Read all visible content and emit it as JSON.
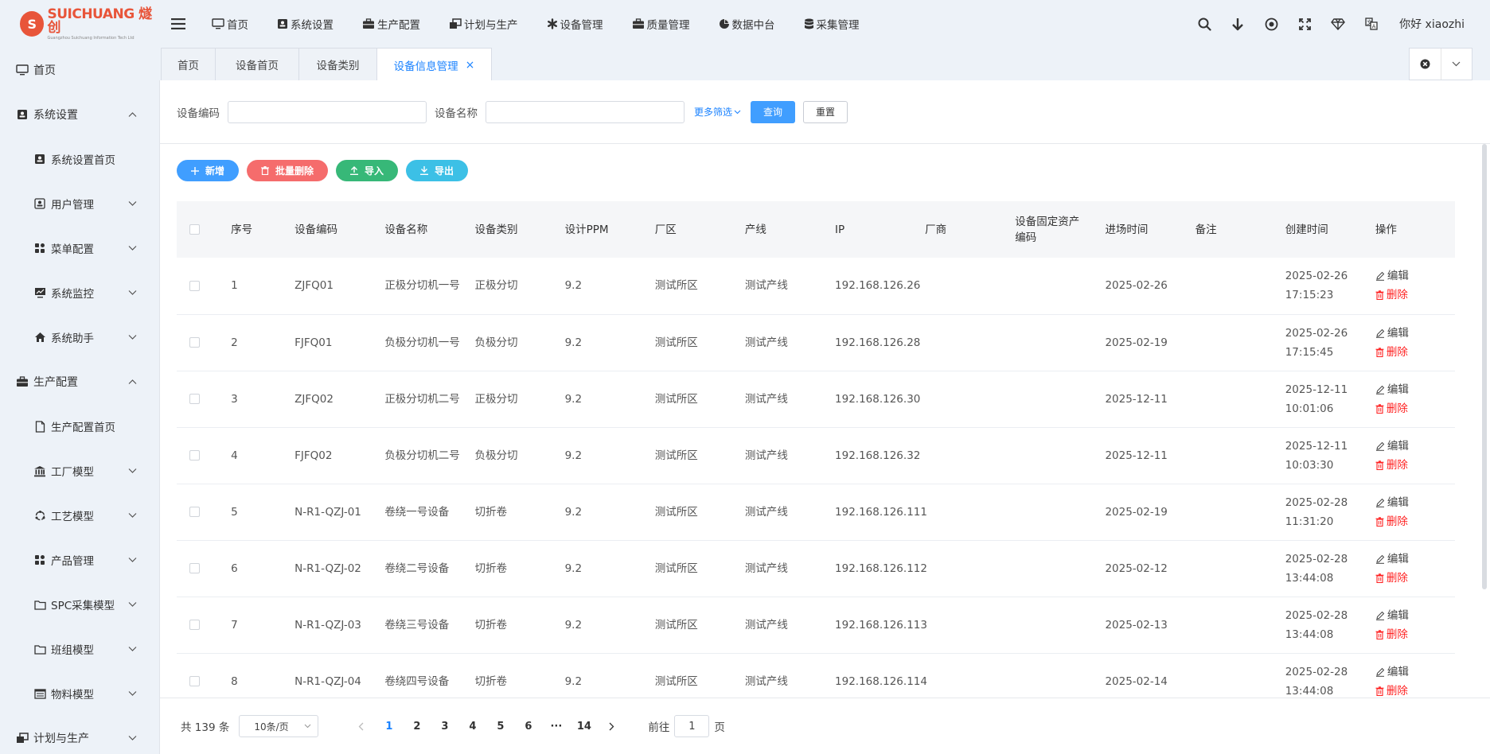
{
  "brand": {
    "logo_main": "SUICHUANG 燧创",
    "logo_sub": "Guangzhou Suichuang Information Tech Ltd",
    "logo_mark": "S"
  },
  "topnav": [
    {
      "label": "首页",
      "icon": "monitor-icon"
    },
    {
      "label": "系统设置",
      "icon": "user-card-icon"
    },
    {
      "label": "生产配置",
      "icon": "briefcase-icon"
    },
    {
      "label": "计划与生产",
      "icon": "windows-icon"
    },
    {
      "label": "设备管理",
      "icon": "gear-star-icon"
    },
    {
      "label": "质量管理",
      "icon": "briefcase-icon"
    },
    {
      "label": "数据中台",
      "icon": "pie-icon"
    },
    {
      "label": "采集管理",
      "icon": "database-icon"
    }
  ],
  "header": {
    "greeting": "你好 xiaozhi"
  },
  "sidebar": [
    {
      "label": "首页",
      "level": 0,
      "icon": "monitor-icon",
      "chevron": "none"
    },
    {
      "label": "系统设置",
      "level": 0,
      "icon": "user-card-icon",
      "chevron": "up"
    },
    {
      "label": "系统设置首页",
      "level": 1,
      "icon": "user-card-icon",
      "chevron": "none"
    },
    {
      "label": "用户管理",
      "level": 1,
      "icon": "user-box-icon",
      "chevron": "down"
    },
    {
      "label": "菜单配置",
      "level": 1,
      "icon": "grid-icon",
      "chevron": "down"
    },
    {
      "label": "系统监控",
      "level": 1,
      "icon": "screen-chart-icon",
      "chevron": "down"
    },
    {
      "label": "系统助手",
      "level": 1,
      "icon": "home-icon",
      "chevron": "down"
    },
    {
      "label": "生产配置",
      "level": 0,
      "icon": "briefcase-icon",
      "chevron": "up"
    },
    {
      "label": "生产配置首页",
      "level": 1,
      "icon": "document-icon",
      "chevron": "none"
    },
    {
      "label": "工厂模型",
      "level": 1,
      "icon": "bank-icon",
      "chevron": "down"
    },
    {
      "label": "工艺模型",
      "level": 1,
      "icon": "cycle-icon",
      "chevron": "down"
    },
    {
      "label": "产品管理",
      "level": 1,
      "icon": "grid-icon",
      "chevron": "down"
    },
    {
      "label": "SPC采集模型",
      "level": 1,
      "icon": "folder-icon",
      "chevron": "down"
    },
    {
      "label": "班组模型",
      "level": 1,
      "icon": "folder-icon",
      "chevron": "down"
    },
    {
      "label": "物料模型",
      "level": 1,
      "icon": "list-box-icon",
      "chevron": "down"
    },
    {
      "label": "计划与生产",
      "level": 0,
      "icon": "windows-icon",
      "chevron": "down"
    }
  ],
  "tabs": [
    {
      "label": "首页",
      "active": false
    },
    {
      "label": "设备首页",
      "active": false
    },
    {
      "label": "设备类别",
      "active": false
    },
    {
      "label": "设备信息管理",
      "active": true,
      "closable": true
    }
  ],
  "search": {
    "code_label": "设备编码",
    "code_value": "",
    "code_placeholder": "",
    "name_label": "设备名称",
    "name_value": "",
    "name_placeholder": "",
    "more": "更多筛选",
    "query": "查询",
    "reset": "重置"
  },
  "toolbar": {
    "add": "新增",
    "batch_delete": "批量删除",
    "import": "导入",
    "export": "导出"
  },
  "table": {
    "columns": [
      "序号",
      "设备编码",
      "设备名称",
      "设备类别",
      "设计PPM",
      "厂区",
      "产线",
      "IP",
      "厂商",
      "设备固定资产编码",
      "进场时间",
      "备注",
      "创建时间",
      "操作"
    ],
    "action_edit": "编辑",
    "action_delete": "删除",
    "rows": [
      {
        "no": "1",
        "code": "ZJFQ01",
        "name": "正极分切机一号",
        "type": "正极分切",
        "ppm": "9.2",
        "area": "测试所区",
        "line": "测试产线",
        "ip": "192.168.126.26",
        "vendor": "",
        "asset": "",
        "enter": "2025-02-26",
        "remark": "",
        "created": "2025-02-26 17:15:23"
      },
      {
        "no": "2",
        "code": "FJFQ01",
        "name": "负极分切机一号",
        "type": "负极分切",
        "ppm": "9.2",
        "area": "测试所区",
        "line": "测试产线",
        "ip": "192.168.126.28",
        "vendor": "",
        "asset": "",
        "enter": "2025-02-19",
        "remark": "",
        "created": "2025-02-26 17:15:45"
      },
      {
        "no": "3",
        "code": "ZJFQ02",
        "name": "正极分切机二号",
        "type": "正极分切",
        "ppm": "9.2",
        "area": "测试所区",
        "line": "测试产线",
        "ip": "192.168.126.30",
        "vendor": "",
        "asset": "",
        "enter": "2025-12-11",
        "remark": "",
        "created": "2025-12-11 10:01:06"
      },
      {
        "no": "4",
        "code": "FJFQ02",
        "name": "负极分切机二号",
        "type": "负极分切",
        "ppm": "9.2",
        "area": "测试所区",
        "line": "测试产线",
        "ip": "192.168.126.32",
        "vendor": "",
        "asset": "",
        "enter": "2025-12-11",
        "remark": "",
        "created": "2025-12-11 10:03:30"
      },
      {
        "no": "5",
        "code": "N-R1-QZJ-01",
        "name": "卷绕一号设备",
        "type": "切折卷",
        "ppm": "9.2",
        "area": "测试所区",
        "line": "测试产线",
        "ip": "192.168.126.111",
        "vendor": "",
        "asset": "",
        "enter": "2025-02-19",
        "remark": "",
        "created": "2025-02-28 11:31:20"
      },
      {
        "no": "6",
        "code": "N-R1-QZJ-02",
        "name": "卷绕二号设备",
        "type": "切折卷",
        "ppm": "9.2",
        "area": "测试所区",
        "line": "测试产线",
        "ip": "192.168.126.112",
        "vendor": "",
        "asset": "",
        "enter": "2025-02-12",
        "remark": "",
        "created": "2025-02-28 13:44:08"
      },
      {
        "no": "7",
        "code": "N-R1-QZJ-03",
        "name": "卷绕三号设备",
        "type": "切折卷",
        "ppm": "9.2",
        "area": "测试所区",
        "line": "测试产线",
        "ip": "192.168.126.113",
        "vendor": "",
        "asset": "",
        "enter": "2025-02-13",
        "remark": "",
        "created": "2025-02-28 13:44:08"
      },
      {
        "no": "8",
        "code": "N-R1-QZJ-04",
        "name": "卷绕四号设备",
        "type": "切折卷",
        "ppm": "9.2",
        "area": "测试所区",
        "line": "测试产线",
        "ip": "192.168.126.114",
        "vendor": "",
        "asset": "",
        "enter": "2025-02-14",
        "remark": "",
        "created": "2025-02-28 13:44:08"
      }
    ]
  },
  "pagination": {
    "total": "共 139 条",
    "page_size": "10条/页",
    "pages": [
      "1",
      "2",
      "3",
      "4",
      "5",
      "6",
      "···",
      "14"
    ],
    "current": "1",
    "goto_label": "前往",
    "goto_value": "1",
    "page_suffix": "页"
  },
  "colors": {
    "primary": "#409eff",
    "accent_link": "#1a82ff",
    "danger": "#f56c6c",
    "success": "#37b878",
    "info": "#3cc0e6",
    "brand": "#e8553a",
    "chrome_bg": "#edf2f8"
  }
}
